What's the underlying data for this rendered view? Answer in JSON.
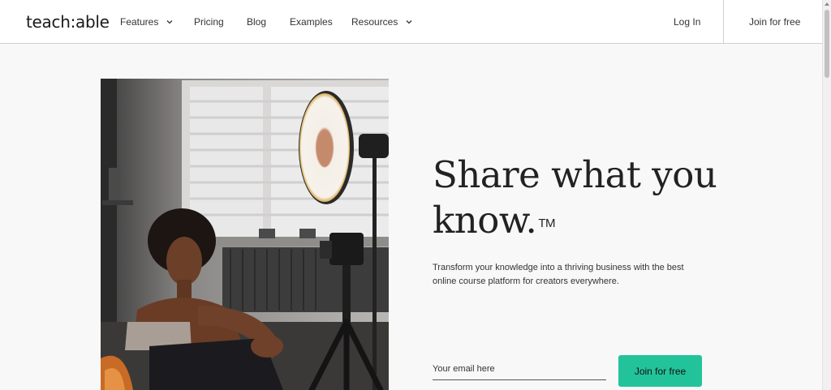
{
  "nav": {
    "logo": "teach:able",
    "items": [
      {
        "label": "Features",
        "has_dropdown": true
      },
      {
        "label": "Pricing",
        "has_dropdown": false
      },
      {
        "label": "Blog",
        "has_dropdown": false
      },
      {
        "label": "Examples",
        "has_dropdown": false
      },
      {
        "label": "Resources",
        "has_dropdown": true
      }
    ],
    "login": "Log In",
    "join": "Join for free"
  },
  "hero": {
    "headline_line1": "Share what you",
    "headline_line2": "know.",
    "trademark": "TM",
    "subtext": "Transform your knowledge into a thriving business with the best online course platform for creators everywhere.",
    "email_placeholder": "Your email here",
    "cta_label": "Join for free",
    "image_description_icon": "creator-photo"
  },
  "colors": {
    "accent": "#22c39a",
    "text": "#222222",
    "background": "#f8f8f8"
  }
}
